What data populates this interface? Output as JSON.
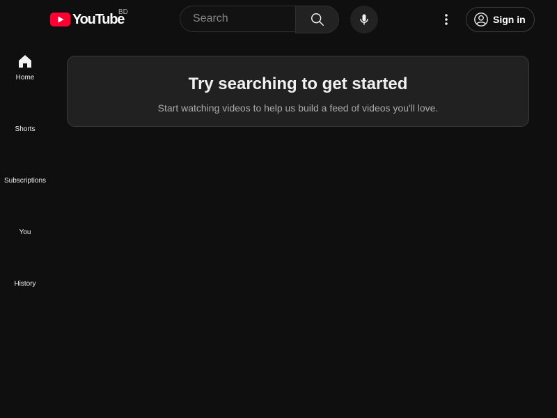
{
  "header": {
    "logo_text": "YouTube",
    "country_code": "BD",
    "search_placeholder": "Search",
    "search_value": "",
    "signin_label": "Sign in"
  },
  "guide": {
    "items": [
      {
        "label": "Home",
        "icon": "home-icon"
      },
      {
        "label": "Shorts",
        "icon": "shorts-icon"
      },
      {
        "label": "Subscriptions",
        "icon": "subscriptions-icon"
      },
      {
        "label": "You",
        "icon": "you-icon"
      },
      {
        "label": "History",
        "icon": "history-icon"
      }
    ]
  },
  "main": {
    "promo_title": "Try searching to get started",
    "promo_body": "Start watching videos to help us build a feed of videos you'll love."
  },
  "colors": {
    "background": "#0f0f0f",
    "brand_red": "#ff0033",
    "signin_accent": "#3ea6ff"
  }
}
